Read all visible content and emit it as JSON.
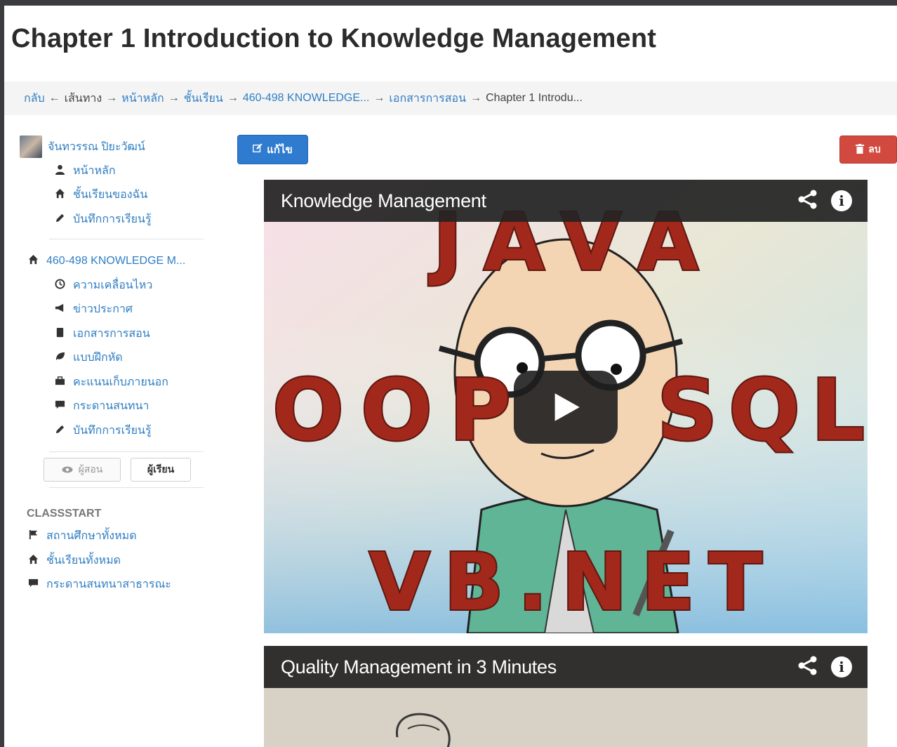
{
  "page": {
    "title": "Chapter 1 Introduction to Knowledge Management"
  },
  "breadcrumb": {
    "items": [
      "กลับ",
      "เส้นทาง",
      "หน้าหลัก",
      "ชั้นเรียน",
      "460-498 KNOWLEDGE...",
      "เอกสารการสอน",
      "Chapter 1 Introdu..."
    ],
    "separators": [
      "←",
      "→",
      "→",
      "→",
      "→",
      "→"
    ]
  },
  "sidebar": {
    "user": {
      "name": "จันทวรรณ ปิยะวัฒน์"
    },
    "user_links": [
      {
        "icon": "user-icon",
        "label": "หน้าหลัก"
      },
      {
        "icon": "home-icon",
        "label": "ชั้นเรียนของฉัน"
      },
      {
        "icon": "pencil-icon",
        "label": "บันทึกการเรียนรู้"
      }
    ],
    "course": {
      "icon": "home-icon",
      "label": "460-498 KNOWLEDGE M..."
    },
    "course_links": [
      {
        "icon": "clock-icon",
        "label": "ความเคลื่อนไหว"
      },
      {
        "icon": "bullhorn-icon",
        "label": "ข่าวประกาศ"
      },
      {
        "icon": "book-icon",
        "label": "เอกสารการสอน"
      },
      {
        "icon": "leaf-icon",
        "label": "แบบฝึกหัด"
      },
      {
        "icon": "briefcase-icon",
        "label": "คะแนนเก็บภายนอก"
      },
      {
        "icon": "comment-icon",
        "label": "กระดานสนทนา"
      },
      {
        "icon": "pencil-icon",
        "label": "บันทึกการเรียนรู้"
      }
    ],
    "roles": {
      "teacher": "ผู้สอน",
      "student": "ผู้เรียน"
    },
    "section_title": "CLASSSTART",
    "global_links": [
      {
        "icon": "flag-icon",
        "label": "สถานศึกษาทั้งหมด"
      },
      {
        "icon": "home-icon",
        "label": "ชั้นเรียนทั้งหมด"
      },
      {
        "icon": "comment-icon",
        "label": "กระดานสนทนาสาธารณะ"
      }
    ]
  },
  "toolbar": {
    "edit_label": "แก้ไข",
    "delete_label": "ลบ"
  },
  "videos": [
    {
      "title": "Knowledge Management",
      "thumb_words": [
        "JAVA",
        "OOP",
        "SQL",
        "VB.NET"
      ]
    },
    {
      "title": "Quality Management in 3 Minutes"
    }
  ],
  "colors": {
    "link": "#2f7ec3",
    "edit_button": "#2e7bd0",
    "delete_button": "#d24a3f",
    "thumb_text": "#a2281b"
  }
}
